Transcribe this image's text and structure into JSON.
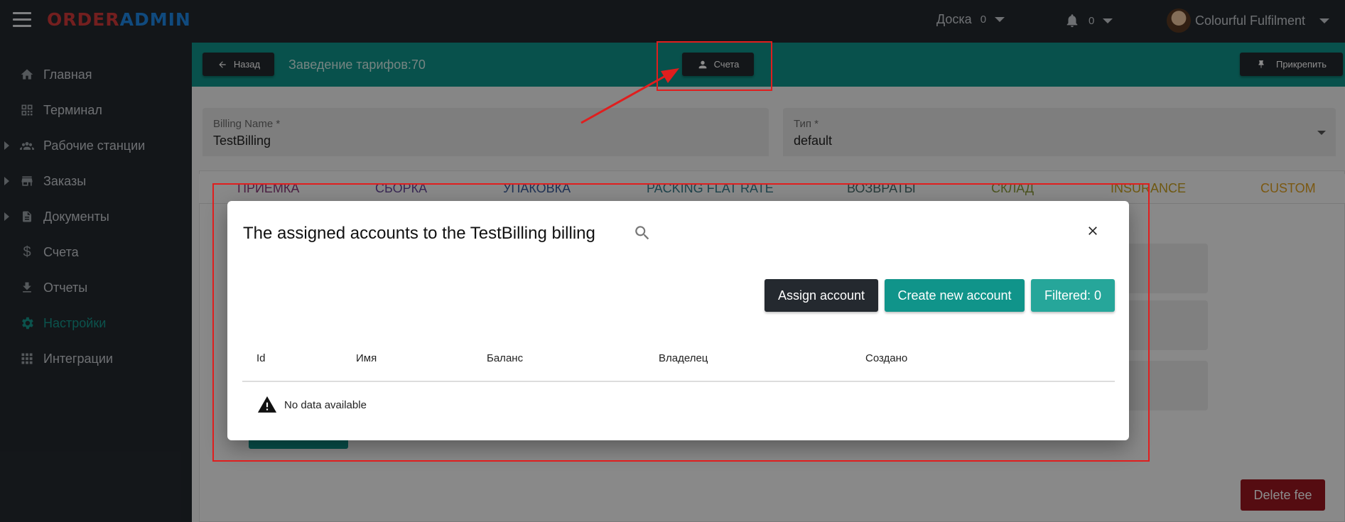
{
  "topbar": {
    "logo_part1": "ORDER",
    "logo_part2": "ADMIN",
    "board_label": "Доска",
    "board_count": "0",
    "notif_count": "0",
    "user_name": "Colourful Fulfilment"
  },
  "sidebar": {
    "items": [
      {
        "label": "Главная",
        "icon": "home-icon"
      },
      {
        "label": "Терминал",
        "icon": "qr-icon"
      },
      {
        "label": "Рабочие станции",
        "icon": "people-icon"
      },
      {
        "label": "Заказы",
        "icon": "store-icon"
      },
      {
        "label": "Документы",
        "icon": "document-icon"
      },
      {
        "label": "Счета",
        "icon": "dollar-icon"
      },
      {
        "label": "Отчеты",
        "icon": "download-icon"
      },
      {
        "label": "Настройки",
        "icon": "gear-icon"
      },
      {
        "label": "Интеграции",
        "icon": "grid-icon"
      }
    ]
  },
  "actionbar": {
    "back_label": "Назад",
    "title": "Заведение тарифов:70",
    "accounts_label": "Счета",
    "pin_label": "Прикрепить"
  },
  "form": {
    "billing_name_label": "Billing Name *",
    "billing_name_value": "TestBilling",
    "type_label": "Тип *",
    "type_value": "default"
  },
  "tabs": [
    {
      "label": "ПРИЕМКА",
      "color": "#8a3a7a"
    },
    {
      "label": "СБОРКА",
      "color": "#6a4a9a"
    },
    {
      "label": "УПАКОВКА",
      "color": "#3a5a9a"
    },
    {
      "label": "PACKING FLAT RATE",
      "color": "#3a7a8a"
    },
    {
      "label": "ВОЗВРАТЫ",
      "color": "#4a6a6a"
    },
    {
      "label": "СКЛАД",
      "color": "#8a9a3a"
    },
    {
      "label": "INSURANCE",
      "color": "#c9a020"
    },
    {
      "label": "CUSTOM",
      "color": "#e0a020"
    }
  ],
  "modal": {
    "title": "The assigned accounts to the TestBilling billing",
    "assign_label": "Assign account",
    "create_label": "Create new account",
    "filtered_label": "Filtered: 0",
    "columns": [
      "Id",
      "Имя",
      "Баланс",
      "Владелец",
      "Создано"
    ],
    "empty_text": "No data available"
  },
  "delete_label": "Delete fee",
  "colors": {
    "teal": "#10948a",
    "dark": "#24292f",
    "danger": "#9c1620",
    "annotation": "#e01e1e"
  }
}
